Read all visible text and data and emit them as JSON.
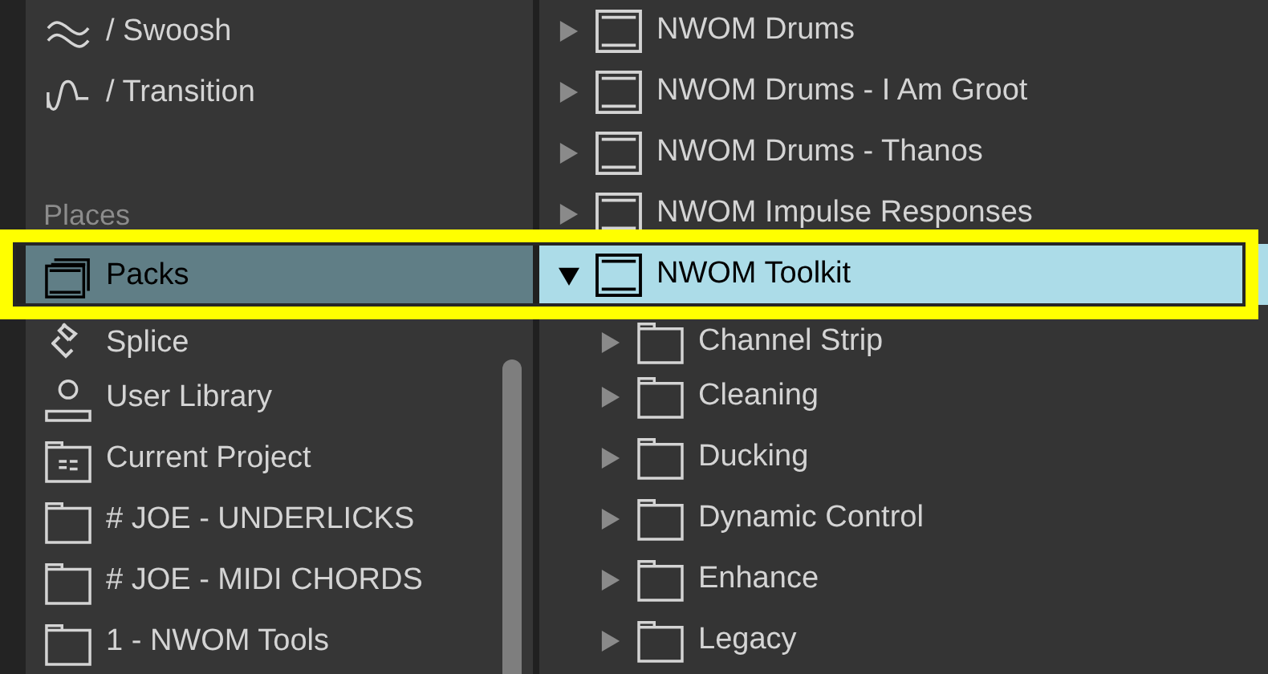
{
  "sidebar": {
    "items": [
      {
        "kind": "wave",
        "label": "/ Swoosh",
        "selected": false
      },
      {
        "kind": "transition",
        "label": "/ Transition",
        "selected": false
      }
    ],
    "places": {
      "title": "Places",
      "items": [
        {
          "kind": "pack",
          "label": "Packs",
          "selected": true
        },
        {
          "kind": "splice",
          "label": "Splice",
          "selected": false
        },
        {
          "kind": "user",
          "label": "User Library",
          "selected": false
        },
        {
          "kind": "project",
          "label": "Current Project",
          "selected": false
        },
        {
          "kind": "folder",
          "label": "# JOE - UNDERLICKS",
          "selected": false
        },
        {
          "kind": "folder",
          "label": "# JOE - MIDI CHORDS",
          "selected": false
        },
        {
          "kind": "folder",
          "label": "1 - NWOM Tools",
          "selected": false
        }
      ]
    }
  },
  "tree": [
    {
      "kind": "pack",
      "label": "NWOM Drums",
      "expanded": false,
      "selected": false
    },
    {
      "kind": "pack",
      "label": "NWOM Drums - I Am Groot",
      "expanded": false,
      "selected": false
    },
    {
      "kind": "pack",
      "label": "NWOM Drums - Thanos",
      "expanded": false,
      "selected": false
    },
    {
      "kind": "pack",
      "label": "NWOM Impulse Responses",
      "expanded": false,
      "selected": false
    },
    {
      "kind": "pack",
      "label": "NWOM Toolkit",
      "expanded": true,
      "selected": true,
      "children": [
        {
          "kind": "folder",
          "label": "Channel Strip",
          "expanded": false,
          "selected": false
        },
        {
          "kind": "folder",
          "label": "Cleaning",
          "expanded": false,
          "selected": false
        },
        {
          "kind": "folder",
          "label": "Ducking",
          "expanded": false,
          "selected": false
        },
        {
          "kind": "folder",
          "label": "Dynamic Control",
          "expanded": false,
          "selected": false
        },
        {
          "kind": "folder",
          "label": "Enhance",
          "expanded": false,
          "selected": false
        },
        {
          "kind": "folder",
          "label": "Legacy",
          "expanded": false,
          "selected": false
        }
      ]
    }
  ]
}
